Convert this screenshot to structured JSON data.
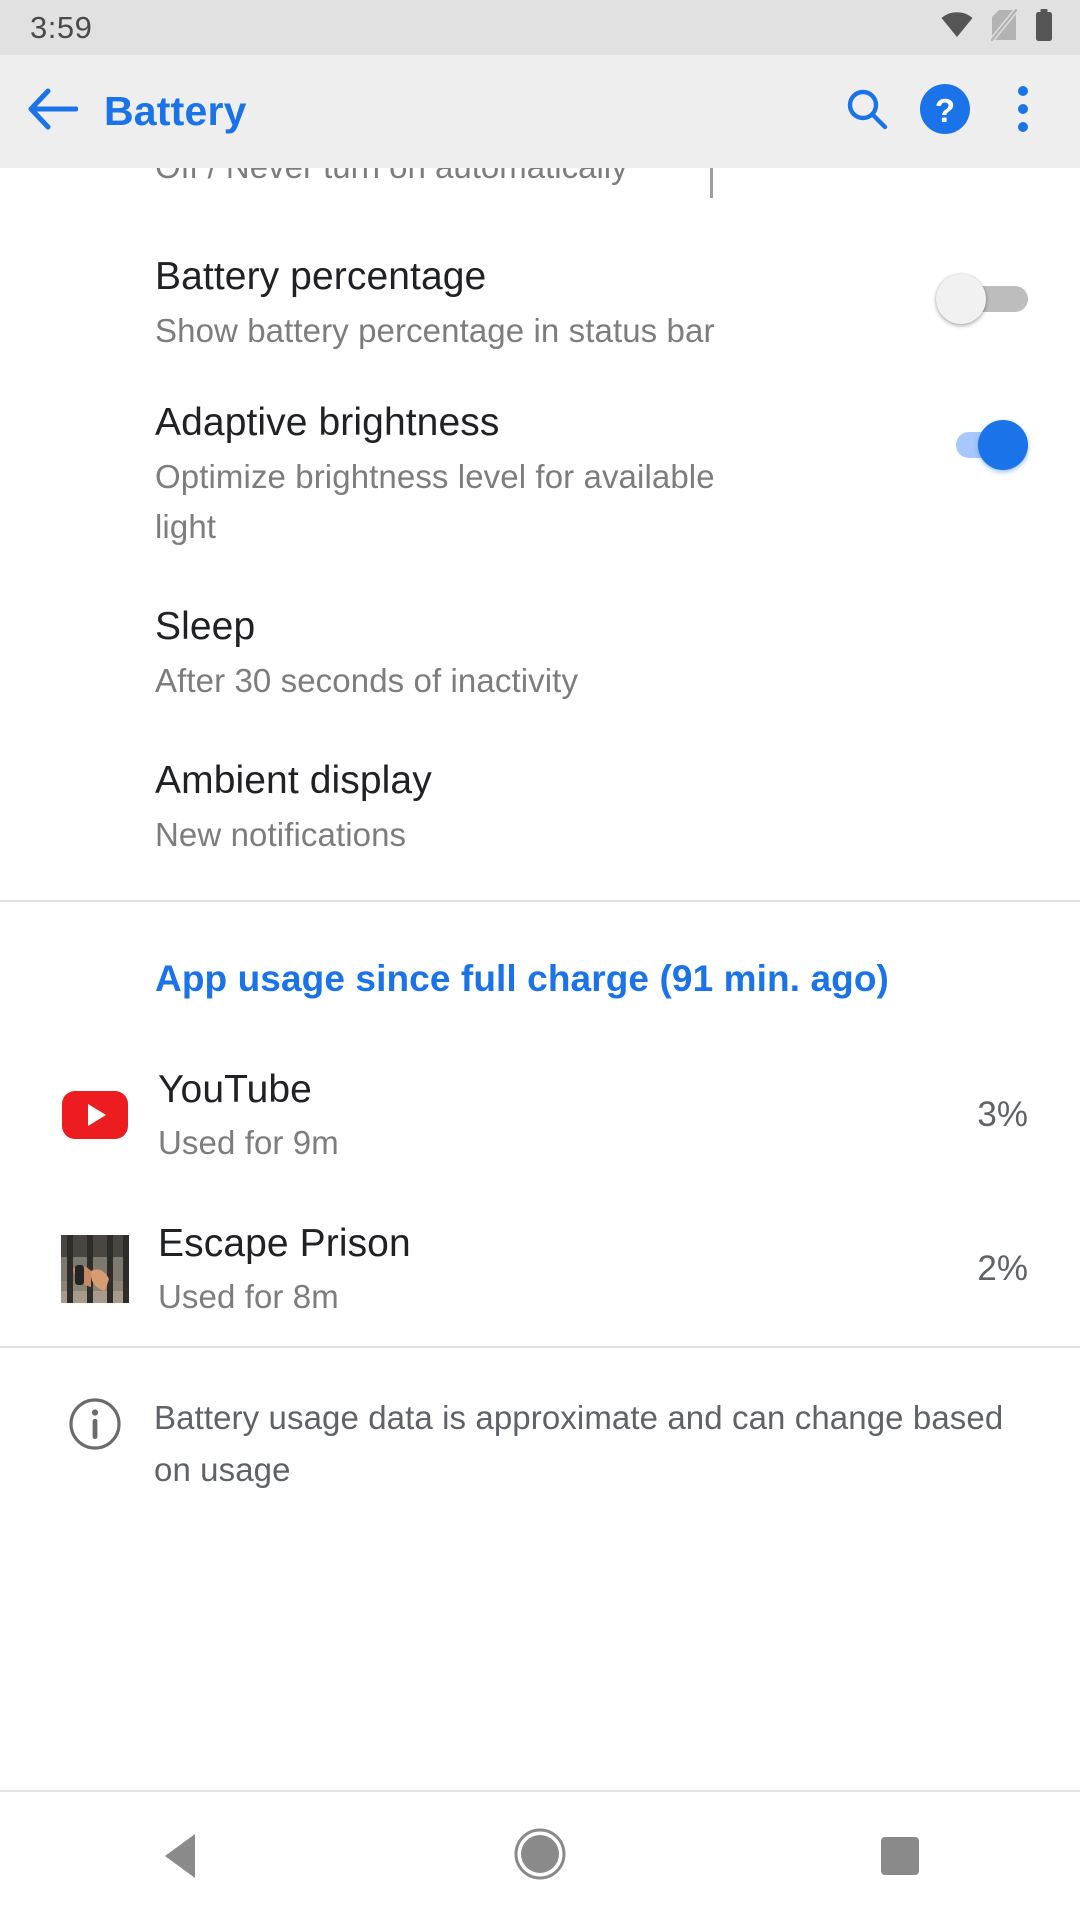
{
  "status_bar": {
    "time": "3:59",
    "icons": [
      "wifi-icon",
      "no-sim-icon",
      "battery-full-icon"
    ]
  },
  "app_bar": {
    "title": "Battery",
    "back_icon": "back-arrow-icon",
    "actions": [
      "search-icon",
      "help-icon",
      "overflow-menu-icon"
    ],
    "accent_color": "#1a73e8"
  },
  "clipped_row": {
    "subtitle": "Off / Never turn on automatically"
  },
  "preferences": [
    {
      "title": "Battery percentage",
      "subtitle": "Show battery percentage in status bar",
      "control": "switch",
      "checked": false
    },
    {
      "title": "Adaptive brightness",
      "subtitle": "Optimize brightness level for available light",
      "control": "switch",
      "checked": true
    },
    {
      "title": "Sleep",
      "subtitle": "After 30 seconds of inactivity",
      "control": "none"
    },
    {
      "title": "Ambient display",
      "subtitle": "New notifications",
      "control": "none"
    }
  ],
  "app_usage": {
    "header": "App usage since full charge (91 min. ago)",
    "header_color": "#1a73e8",
    "apps": [
      {
        "name": "YouTube",
        "usage": "Used for 9m",
        "percent": "3%",
        "icon": "youtube-icon"
      },
      {
        "name": "Escape Prison",
        "usage": "Used for 8m",
        "percent": "2%",
        "icon": "escape-prison-icon"
      }
    ]
  },
  "footer": {
    "icon": "info-icon",
    "text": "Battery usage data is approximate and can change based on usage"
  },
  "nav_bar": {
    "buttons": [
      "back-nav-icon",
      "home-nav-icon",
      "recents-nav-icon"
    ]
  }
}
